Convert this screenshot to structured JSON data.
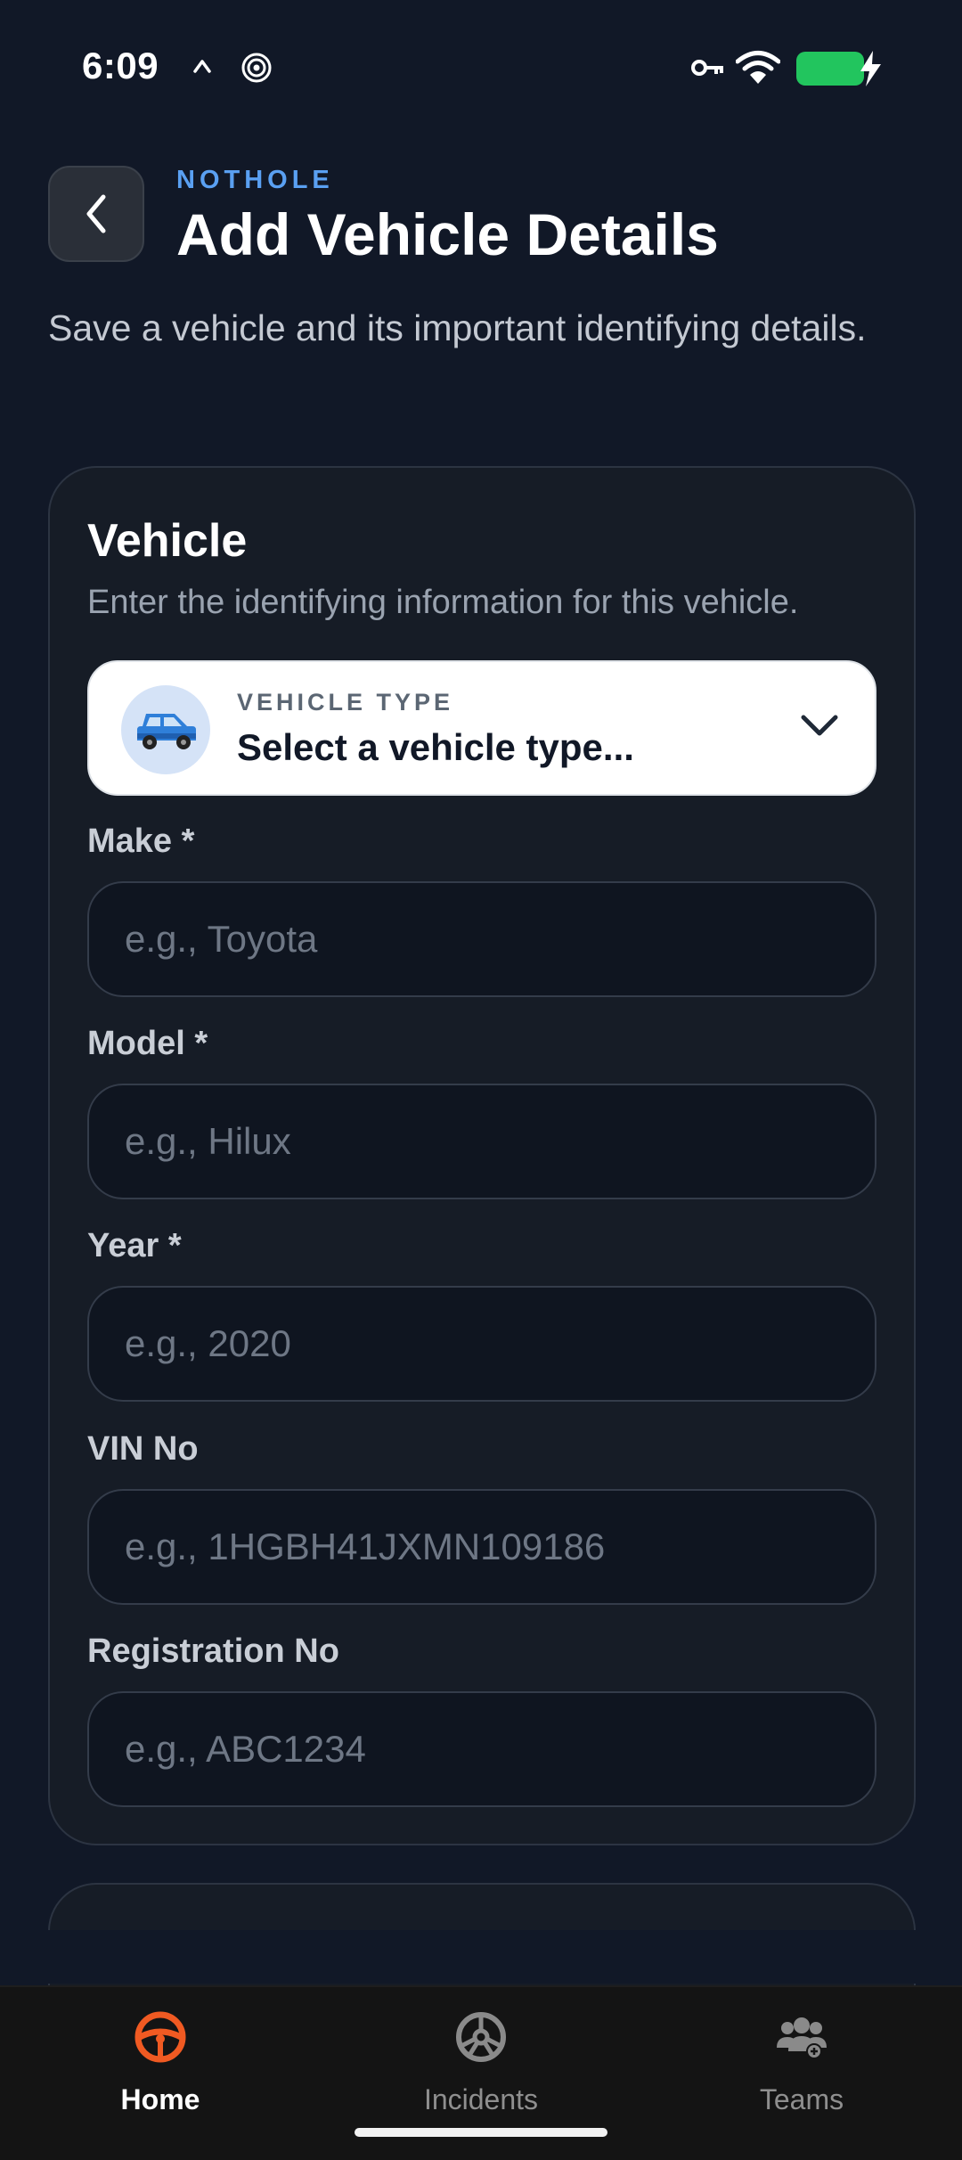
{
  "status_bar": {
    "time": "6:09"
  },
  "header": {
    "brand": "NOTHOLE",
    "title": "Add Vehicle Details",
    "subtitle": "Save a vehicle and its important identifying details."
  },
  "vehicle_card": {
    "title": "Vehicle",
    "subtitle": "Enter the identifying information for this vehicle.",
    "vehicle_type": {
      "label": "VEHICLE TYPE",
      "value": "Select a vehicle type..."
    },
    "fields": {
      "make": {
        "label": "Make *",
        "placeholder": "e.g., Toyota"
      },
      "model": {
        "label": "Model *",
        "placeholder": "e.g., Hilux"
      },
      "year": {
        "label": "Year *",
        "placeholder": "e.g., 2020"
      },
      "vin": {
        "label": "VIN No",
        "placeholder": "e.g., 1HGBH41JXMN109186"
      },
      "registration": {
        "label": "Registration No",
        "placeholder": "e.g., ABC1234"
      }
    }
  },
  "bottom_nav": {
    "items": [
      {
        "label": "Home",
        "icon": "steering-wheel-icon",
        "active": true
      },
      {
        "label": "Incidents",
        "icon": "wheel-icon",
        "active": false
      },
      {
        "label": "Teams",
        "icon": "users-icon",
        "active": false
      }
    ]
  },
  "colors": {
    "background": "#111827",
    "accent": "#5aa0f2",
    "active_nav": "#f05a22",
    "battery": "#22c55e"
  }
}
